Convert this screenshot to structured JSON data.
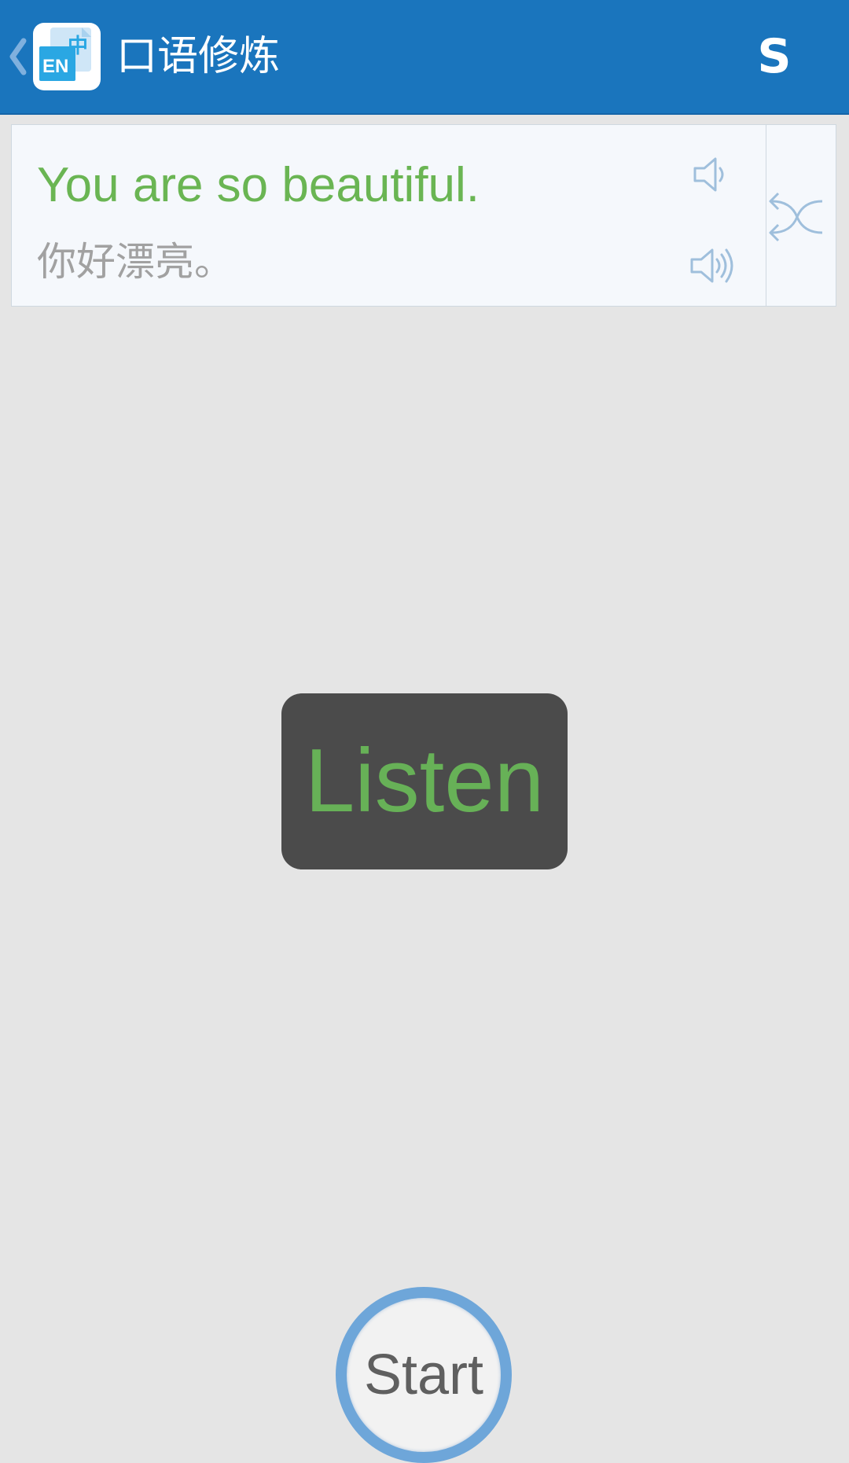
{
  "app_bar": {
    "title": "口语修炼",
    "logo_text_en": "EN",
    "logo_text_zh": "中",
    "menu_label": "S",
    "background_color": "#1a75bd"
  },
  "sentence": {
    "english": "You are so beautiful.",
    "chinese": "你好漂亮。",
    "english_color": "#6ab553",
    "chinese_color": "#a1a1a1"
  },
  "icons": {
    "back": "chevron-left-icon",
    "logo": "app-logo-icon",
    "speaker_english": "speaker-low-volume-icon",
    "speaker_chinese": "speaker-high-volume-icon",
    "shuffle": "shuffle-icon"
  },
  "listen": {
    "label": "Listen",
    "text_color": "#67b157",
    "box_color": "#4b4b4b"
  },
  "start": {
    "label": "Start",
    "ring_color": "#6ea6d9"
  }
}
